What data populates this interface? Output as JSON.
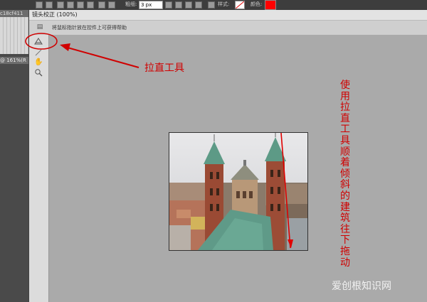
{
  "options_bar": {
    "weight_label": "粗细:",
    "weight_value": "3 px",
    "style_label": "样式:",
    "color_label": "颜色:",
    "color_value": "#ff0000"
  },
  "document": {
    "tab_label": "c18cf411",
    "status_text": "@ 161%(R"
  },
  "dialog": {
    "title": "镜头校正 (100%)",
    "hint": "将鼠标指针放在控件上可获得帮助",
    "tools": [
      {
        "name": "remove-distortion-tool",
        "icon": "grid-icon"
      },
      {
        "name": "straighten-tool",
        "icon": "straighten-icon"
      },
      {
        "name": "move-grid-tool",
        "icon": "move-grid-icon"
      },
      {
        "name": "hand-tool",
        "icon": "hand-icon"
      },
      {
        "name": "zoom-tool",
        "icon": "zoom-icon"
      }
    ]
  },
  "annotations": {
    "tool_label": "拉直工具",
    "instruction": "使用拉直工具顺着倾斜的建筑往下拖动",
    "color": "#d00000"
  },
  "watermark": "爱创根知识网"
}
